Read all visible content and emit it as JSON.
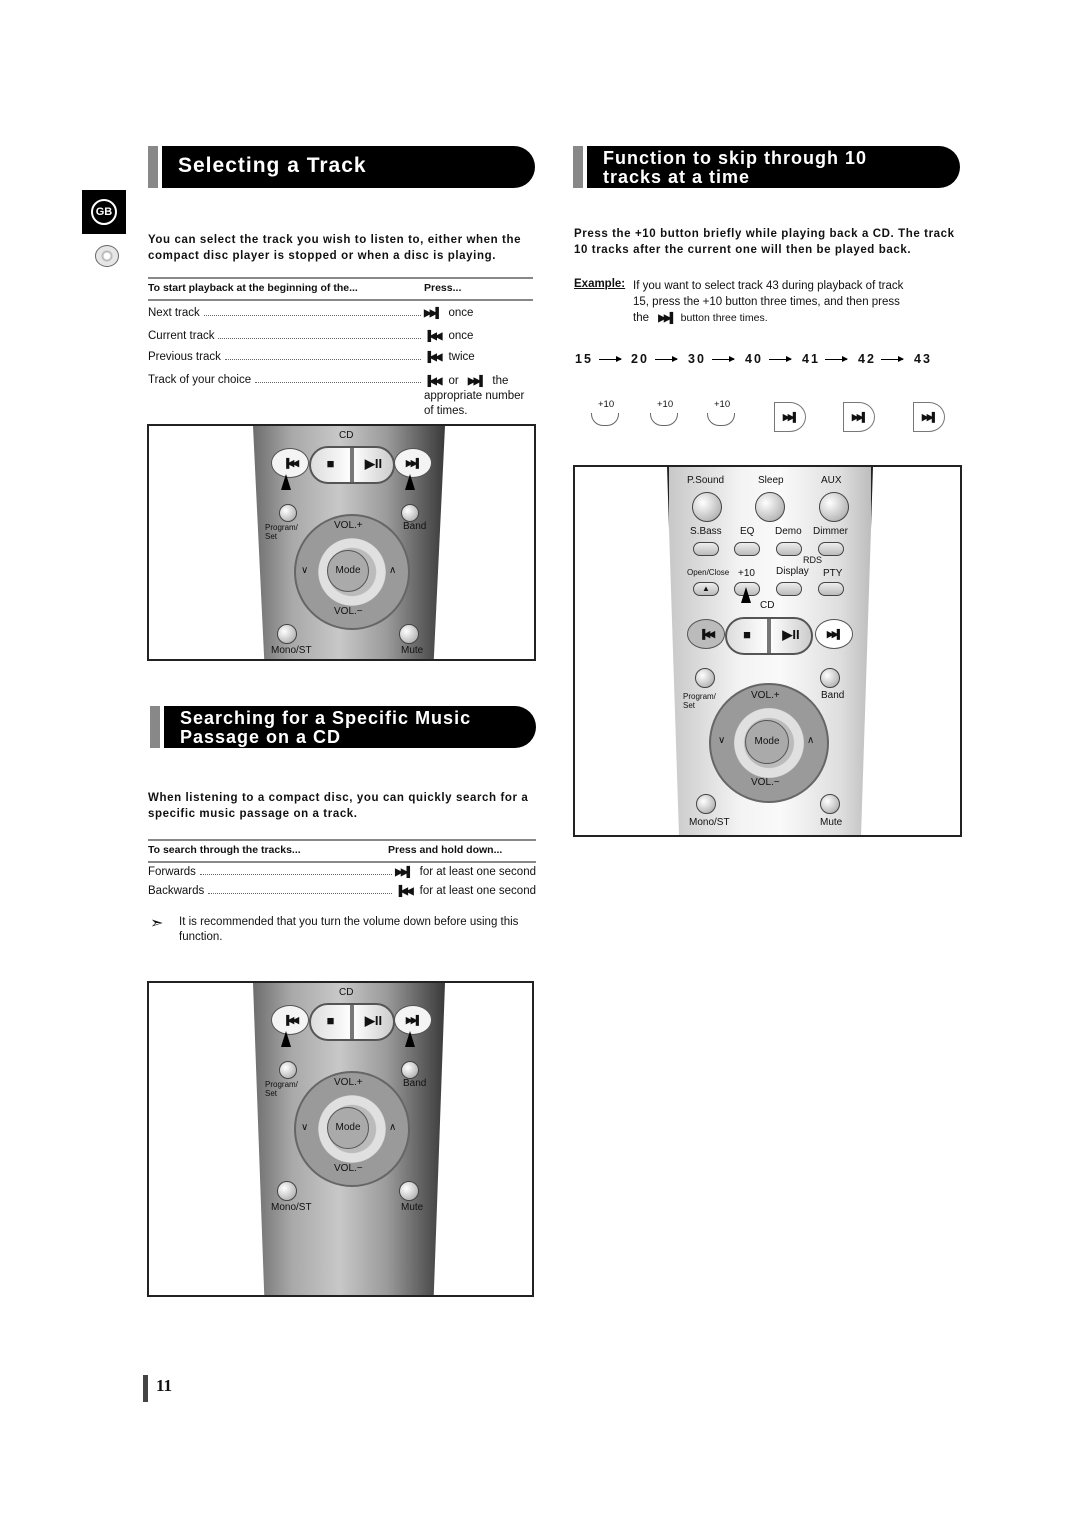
{
  "language_badge": "GB",
  "sections": {
    "selecting_track": {
      "title": "Selecting a Track",
      "intro": "You can select the track you wish to listen to, either when the compact disc player is stopped or when a disc is playing.",
      "table_headers": [
        "To start playback at the beginning of the...",
        "Press..."
      ],
      "rows": [
        {
          "label": "Next track",
          "icon": "next-track-icon",
          "glyph": "▶▶▌",
          "action": "once"
        },
        {
          "label": "Current track",
          "icon": "previous-track-icon",
          "glyph": "▐◀◀",
          "action": "once"
        },
        {
          "label": "Previous track",
          "icon": "previous-track-icon",
          "glyph": "▐◀◀",
          "action": "twice"
        },
        {
          "label": "Track of your choice",
          "icon": "prev-or-next-icon",
          "glyph": "▐◀◀",
          "action_prefix": "or",
          "glyph2": "▶▶▌",
          "action": "the appropriate number of times."
        }
      ]
    },
    "skip_ten": {
      "title_line1": "Function to skip through 10",
      "title_line2": "tracks at a time",
      "intro": "Press the +10 button briefly while playing back a CD. The track 10 tracks after the current one will then be played back.",
      "example_label": "Example:",
      "example_text_1": "If you want to select track 43 during playback of track",
      "example_text_2": "15, press the +10 button three times, and then press",
      "example_text_3": "the",
      "example_text_4": "button three times.",
      "sequence": [
        "15",
        "20",
        "30",
        "40",
        "41",
        "42",
        "43"
      ],
      "plus_buttons": [
        "+10",
        "+10",
        "+10"
      ],
      "ffwd_glyph": "▶▶▌"
    },
    "searching": {
      "title_line1": "Searching for a Specific Music",
      "title_line2": "Passage on a CD",
      "intro": "When listening to a compact disc, you can quickly search for a specific music passage on a track.",
      "table_headers": [
        "To search through the tracks...",
        "Press and hold down..."
      ],
      "rows": [
        {
          "label": "Forwards",
          "glyph": "▶▶▌",
          "action": "for at least one second"
        },
        {
          "label": "Backwards",
          "glyph": "▐◀◀",
          "action": "for at least one second"
        }
      ],
      "note": "It is recommended that you turn the volume down before using this function."
    }
  },
  "remote_small": {
    "cd_label": "CD",
    "prev": "▐◀◀",
    "stop": "■",
    "play_pause": "▶II",
    "next": "▶▶▌",
    "program_set": "Program/ Set",
    "band": "Band",
    "vol_plus": "VOL.+",
    "vol_minus": "VOL.−",
    "mode": "Mode",
    "down": "∨",
    "up": "∧",
    "mono_st": "Mono/ST",
    "mute": "Mute"
  },
  "remote_full": {
    "row1": [
      "P.Sound",
      "Sleep",
      "AUX"
    ],
    "row2": [
      "S.Bass",
      "EQ",
      "Demo",
      "Dimmer"
    ],
    "rds_label": "RDS",
    "row3": [
      "Open/Close",
      "+10",
      "Display",
      "PTY"
    ],
    "eject": "▲",
    "cd_label": "CD",
    "prev": "▐◀◀",
    "stop": "■",
    "play_pause": "▶II",
    "next": "▶▶▌",
    "program_set": "Program/ Set",
    "band": "Band",
    "vol_plus": "VOL.+",
    "vol_minus": "VOL.−",
    "mode": "Mode",
    "down": "∨",
    "up": "∧",
    "mono_st": "Mono/ST",
    "mute": "Mute"
  },
  "page_number": "11"
}
